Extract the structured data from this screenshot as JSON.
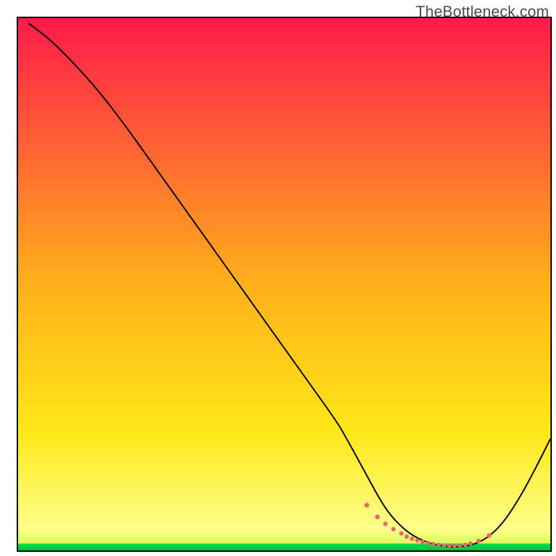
{
  "watermark": "TheBottleneck.com",
  "chart_data": {
    "type": "line",
    "title": "",
    "xlabel": "",
    "ylabel": "",
    "xlim": [
      0,
      100
    ],
    "ylim": [
      0,
      100
    ],
    "series": [
      {
        "name": "bottleneck-curve",
        "x": [
          2,
          6,
          10,
          15,
          20,
          25,
          30,
          35,
          40,
          45,
          50,
          55,
          60,
          62,
          65,
          68,
          70,
          73,
          76,
          79,
          82,
          85,
          88,
          91,
          94,
          97,
          100
        ],
        "y": [
          99,
          96,
          92,
          86.5,
          80,
          73,
          66,
          59,
          52,
          45,
          38,
          31,
          24,
          20.5,
          15,
          9.5,
          6.5,
          3.5,
          1.8,
          0.9,
          0.6,
          0.9,
          2.2,
          5,
          9.5,
          15,
          21
        ]
      }
    ],
    "markers": {
      "name": "highlight-points",
      "color": "#e66a6a",
      "x": [
        65.5,
        67.5,
        69,
        70.5,
        72,
        73,
        74,
        75,
        76,
        77,
        78,
        79,
        80,
        81,
        82,
        83,
        84,
        85,
        86.5,
        88.5
      ],
      "y": [
        8.5,
        6.3,
        5.0,
        4.0,
        3.2,
        2.6,
        2.2,
        1.9,
        1.6,
        1.4,
        1.2,
        1.05,
        0.95,
        0.9,
        0.88,
        0.92,
        1.05,
        1.3,
        1.8,
        2.8
      ],
      "r": [
        3.5,
        3.5,
        3.2,
        3.2,
        3.2,
        3.2,
        3.2,
        3.2,
        3.2,
        3.2,
        3.2,
        3.2,
        3.2,
        3.2,
        3.2,
        3.2,
        3.2,
        3.2,
        3.2,
        3.5
      ]
    },
    "gradient": {
      "top_color": "#ff1a4a",
      "mid_color": "#ffd21a",
      "lower_color": "#ffff6a",
      "band_color": "#00e04a",
      "band_height_pct": 1.3
    }
  }
}
